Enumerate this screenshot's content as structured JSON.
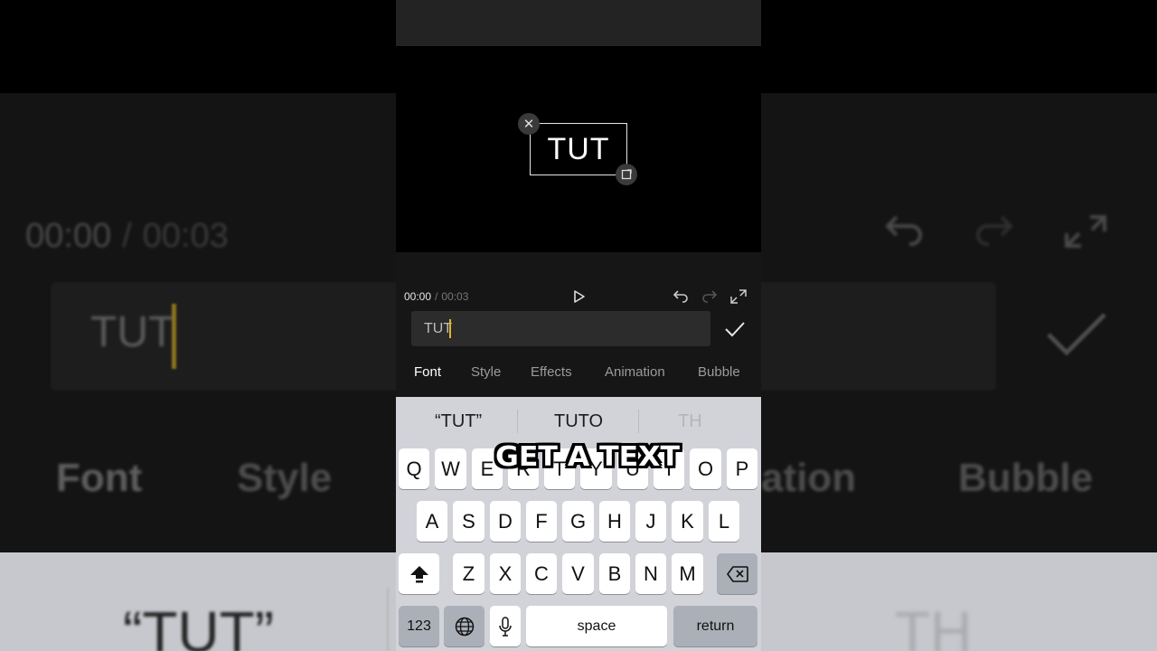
{
  "background": {
    "current_time": "00:00",
    "duration": "00:03",
    "input_text": "TUT",
    "tabs": [
      "Font",
      "Style",
      "ation",
      "Bubble"
    ],
    "suggestion_first": "“TUT”",
    "suggestion_last": "TH"
  },
  "preview": {
    "text_box_label": "TUT"
  },
  "timeline": {
    "current_time": "00:00",
    "separator": "/",
    "duration": "00:03"
  },
  "text_input": {
    "value": "TUT"
  },
  "tabs": {
    "font": "Font",
    "style": "Style",
    "effects": "Effects",
    "animation": "Animation",
    "bubble": "Bubble"
  },
  "keyboard": {
    "suggestions": [
      "“TUT”",
      "TUTO",
      "TH"
    ],
    "row1": [
      "Q",
      "W",
      "E",
      "R",
      "T",
      "Y",
      "U",
      "I",
      "O",
      "P"
    ],
    "row2": [
      "A",
      "S",
      "D",
      "F",
      "G",
      "H",
      "J",
      "K",
      "L"
    ],
    "row3": [
      "Z",
      "X",
      "C",
      "V",
      "B",
      "N",
      "M"
    ],
    "numbers_label": "123",
    "space_label": "space",
    "return_label": "return"
  },
  "caption": "GET A TEXT",
  "colors": {
    "caret": "#e0b52b",
    "keyboard_bg": "#d1d3d9",
    "editor_bg": "#161616"
  }
}
